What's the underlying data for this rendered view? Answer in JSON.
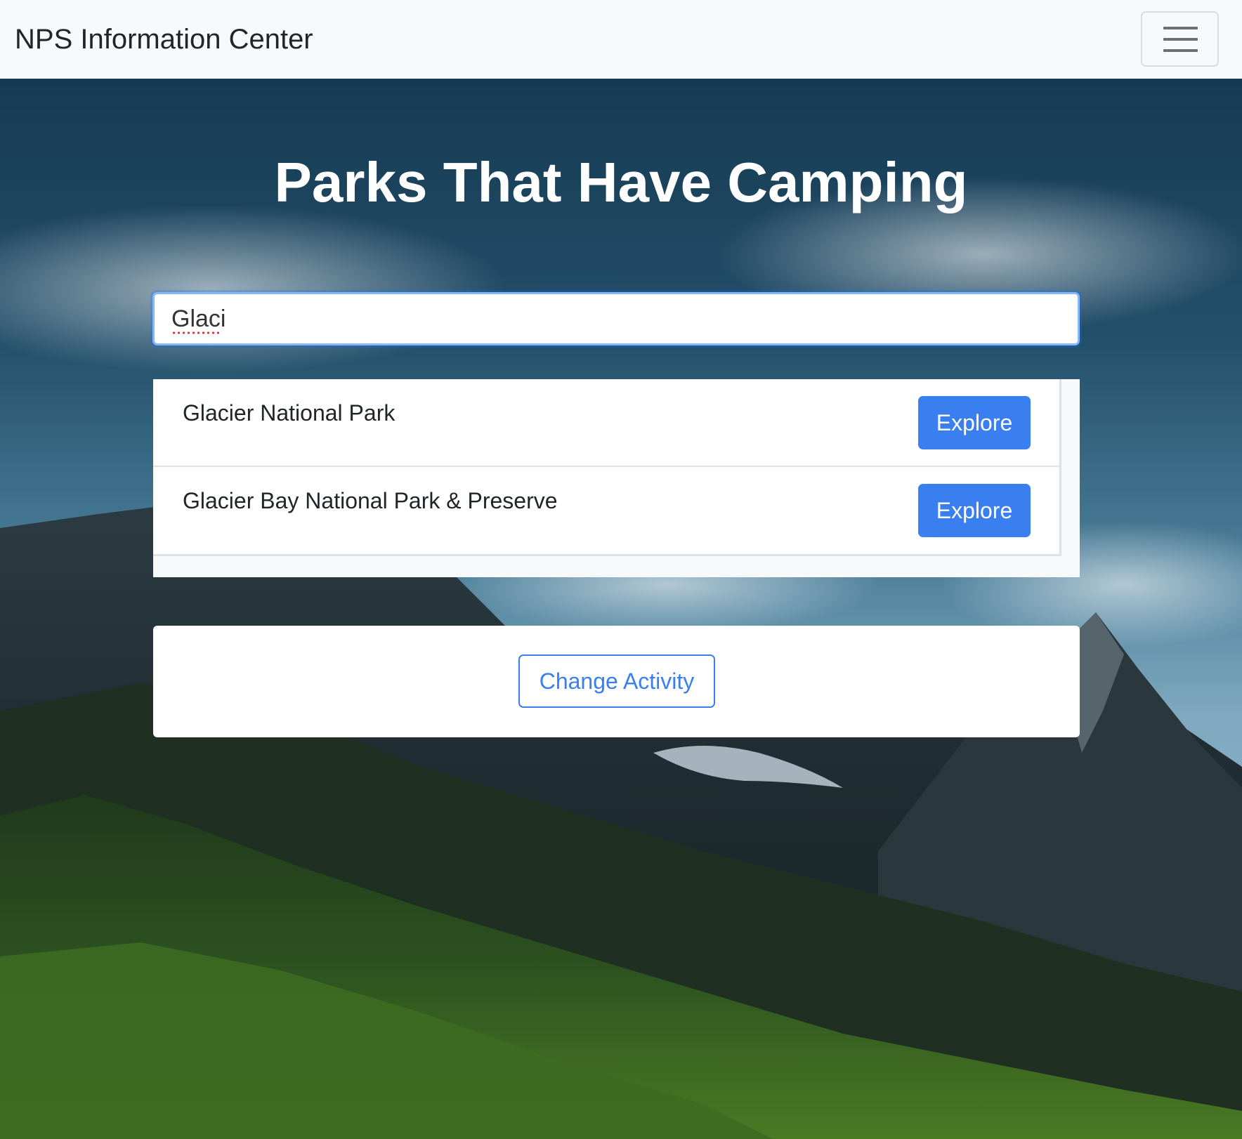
{
  "navbar": {
    "brand": "NPS Information Center",
    "toggler_icon": "hamburger-menu-icon"
  },
  "hero": {
    "title": "Parks That Have Camping"
  },
  "search": {
    "value": "Glaci",
    "misspelled": true
  },
  "results": [
    {
      "name": "Glacier National Park",
      "button_label": "Explore"
    },
    {
      "name": "Glacier Bay National Park & Preserve",
      "button_label": "Explore"
    }
  ],
  "activity": {
    "button_label": "Change Activity"
  },
  "colors": {
    "navbar_bg": "#f8f9fa",
    "primary": "#3a7ff0",
    "focus_border": "#86b7fe",
    "title_text": "#ffffff"
  }
}
